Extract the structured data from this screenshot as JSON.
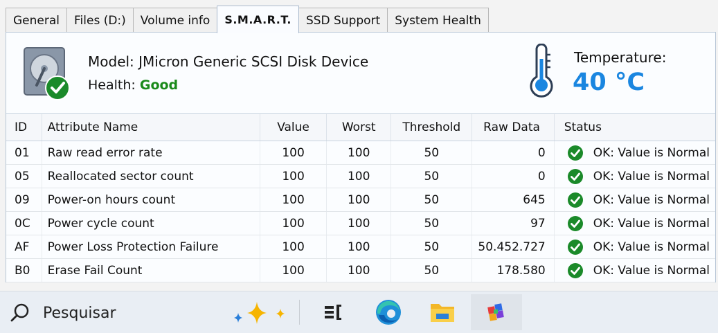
{
  "tabs": [
    {
      "label": "General"
    },
    {
      "label": "Files (D:)"
    },
    {
      "label": "Volume info"
    },
    {
      "label": "S.M.A.R.T."
    },
    {
      "label": "SSD Support"
    },
    {
      "label": "System Health"
    }
  ],
  "active_tab": "S.M.A.R.T.",
  "device": {
    "model_label": "Model:",
    "model": "JMicron Generic SCSI Disk Device",
    "health_label": "Health:",
    "health": "Good",
    "icon": "hard-disk-icon"
  },
  "temperature": {
    "label": "Temperature:",
    "value": "40 °C",
    "icon": "thermometer-icon"
  },
  "table": {
    "headers": {
      "id": "ID",
      "name": "Attribute Name",
      "value": "Value",
      "worst": "Worst",
      "threshold": "Threshold",
      "raw": "Raw Data",
      "status": "Status"
    },
    "rows": [
      {
        "id": "01",
        "name": "Raw read error rate",
        "value": "100",
        "worst": "100",
        "threshold": "50",
        "raw": "0",
        "status": "OK: Value is Normal"
      },
      {
        "id": "05",
        "name": "Reallocated sector count",
        "value": "100",
        "worst": "100",
        "threshold": "50",
        "raw": "0",
        "status": "OK: Value is Normal"
      },
      {
        "id": "09",
        "name": "Power-on hours count",
        "value": "100",
        "worst": "100",
        "threshold": "50",
        "raw": "645",
        "status": "OK: Value is Normal"
      },
      {
        "id": "0C",
        "name": "Power cycle count",
        "value": "100",
        "worst": "100",
        "threshold": "50",
        "raw": "97",
        "status": "OK: Value is Normal"
      },
      {
        "id": "AF",
        "name": "Power Loss Protection Failure",
        "value": "100",
        "worst": "100",
        "threshold": "50",
        "raw": "50.452.727",
        "status": "OK: Value is Normal"
      },
      {
        "id": "B0",
        "name": "Erase Fail Count",
        "value": "100",
        "worst": "100",
        "threshold": "50",
        "raw": "178.580",
        "status": "OK: Value is Normal"
      }
    ]
  },
  "taskbar": {
    "search_placeholder": "Pesquisar",
    "items": [
      "task-view-icon",
      "edge-browser-icon",
      "file-explorer-icon",
      "app-icon"
    ]
  },
  "colors": {
    "health_good": "#1a8a1a",
    "temperature": "#1a86e0",
    "ok_check": "#1b8a2a"
  }
}
